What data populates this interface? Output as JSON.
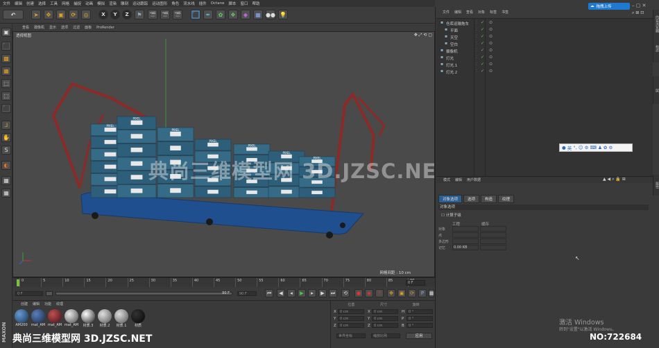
{
  "menubar": [
    "文件",
    "编辑",
    "创建",
    "选择",
    "工具",
    "网格",
    "捕捉",
    "动画",
    "模拟",
    "渲染",
    "雕刻",
    "运动跟踪",
    "运动图形",
    "角色",
    "流水线",
    "插件",
    "Octane",
    "脚本",
    "窗口",
    "帮助"
  ],
  "viewport": {
    "menu": [
      "查看",
      "摄像机",
      "显示",
      "选项",
      "过滤",
      "面板",
      "ProRender"
    ],
    "label": "透视视图",
    "grid_spacing": "网格间距 : 10 cm",
    "watermark": "典尚三维模型网 3D.JZSC.NET",
    "box_text": "PIXEL"
  },
  "timeline": {
    "ticks": [
      "0",
      "5",
      "10",
      "15",
      "20",
      "25",
      "30",
      "35",
      "40",
      "45",
      "50",
      "55",
      "60",
      "65",
      "70",
      "75",
      "80",
      "85",
      "90"
    ],
    "frame_end": "0 F"
  },
  "transport": {
    "current": "0 F",
    "start": "0 F",
    "end_display": "90 F",
    "end": "90 F"
  },
  "materials": {
    "tabs": [
      "创建",
      "编辑",
      "功能",
      "纹理"
    ],
    "items": [
      "AM200",
      "mat_AM",
      "mat_AM",
      "mat_AM",
      "材质.3",
      "材质.2",
      "材质.1",
      "材质"
    ]
  },
  "coords": {
    "header": [
      "位置",
      "尺寸",
      "旋转"
    ],
    "rows": [
      {
        "a": "X",
        "v": "0 cm",
        "b": "X",
        "w": "0 cm",
        "c": "H",
        "r": "0 °"
      },
      {
        "a": "Y",
        "v": "0 cm",
        "b": "Y",
        "w": "0 cm",
        "c": "P",
        "r": "0 °"
      },
      {
        "a": "Z",
        "v": "0 cm",
        "b": "Z",
        "w": "0 cm",
        "c": "B",
        "r": "0 °"
      }
    ],
    "mode": "世界坐标",
    "scale_mode": "缩放比例",
    "apply": "应用"
  },
  "objects": {
    "menu": [
      "文件",
      "编辑",
      "查看",
      "对象",
      "标签",
      "书签"
    ],
    "items": [
      {
        "name": "仓库运输拖车",
        "indent": 0
      },
      {
        "name": "平面",
        "indent": 1
      },
      {
        "name": "天空",
        "indent": 1
      },
      {
        "name": "空白",
        "indent": 1
      },
      {
        "name": "摄像机",
        "indent": 0
      },
      {
        "name": "灯光",
        "indent": 0
      },
      {
        "name": "灯光.1",
        "indent": 0
      },
      {
        "name": "灯光.2",
        "indent": 0
      }
    ]
  },
  "upload_button": "拖拽上传",
  "ime": "英",
  "attributes": {
    "menu": [
      "模式",
      "编辑",
      "用户数据"
    ],
    "tabs": [
      "对象选项",
      "选项",
      "构造",
      "纹理"
    ],
    "section": "对象选项",
    "checkbox": "计算子级",
    "col1": "工程",
    "col2": "缓存",
    "rows": [
      "对象",
      "点",
      "多边形",
      "记忆"
    ],
    "memory_value": "0.00 KB"
  },
  "side_tabs": [
    "内容浏览器",
    "构造",
    "层",
    "属性"
  ],
  "activate": {
    "title": "激活 Windows",
    "subtitle": "转到\"设置\"以激活 Windows。"
  },
  "bottom_watermark": "典尚三维模型网 3D.JZSC.NET",
  "number_id": "NO:722684",
  "maxon": "MAXON"
}
